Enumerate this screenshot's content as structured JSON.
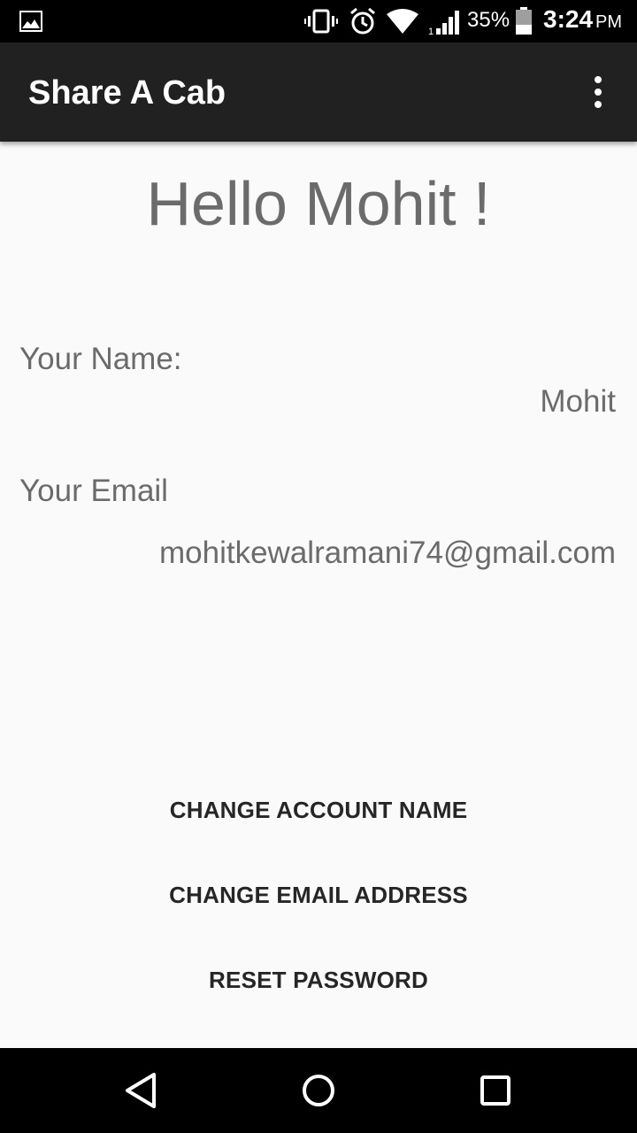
{
  "status_bar": {
    "battery_percent": "35%",
    "time": "3:24",
    "ampm": "PM",
    "icons": [
      "image-icon",
      "vibrate-icon",
      "alarm-icon",
      "wifi-icon",
      "signal-icon",
      "battery-icon"
    ]
  },
  "app_bar": {
    "title": "Share A Cab",
    "menu_icon": "overflow-menu-icon"
  },
  "main": {
    "greeting": "Hello Mohit !",
    "name_label": "Your Name:",
    "name_value": "Mohit",
    "email_label": "Your Email",
    "email_value": "mohitkewalramani74@gmail.com"
  },
  "actions": {
    "change_name": "CHANGE ACCOUNT NAME",
    "change_email": "CHANGE EMAIL ADDRESS",
    "reset_password": "RESET PASSWORD"
  },
  "nav_bar": {
    "icons": [
      "back-icon",
      "home-icon",
      "recent-apps-icon"
    ]
  },
  "colors": {
    "app_bar": "#212121",
    "text_gray": "#6b6b6b",
    "background": "#fafafa"
  }
}
